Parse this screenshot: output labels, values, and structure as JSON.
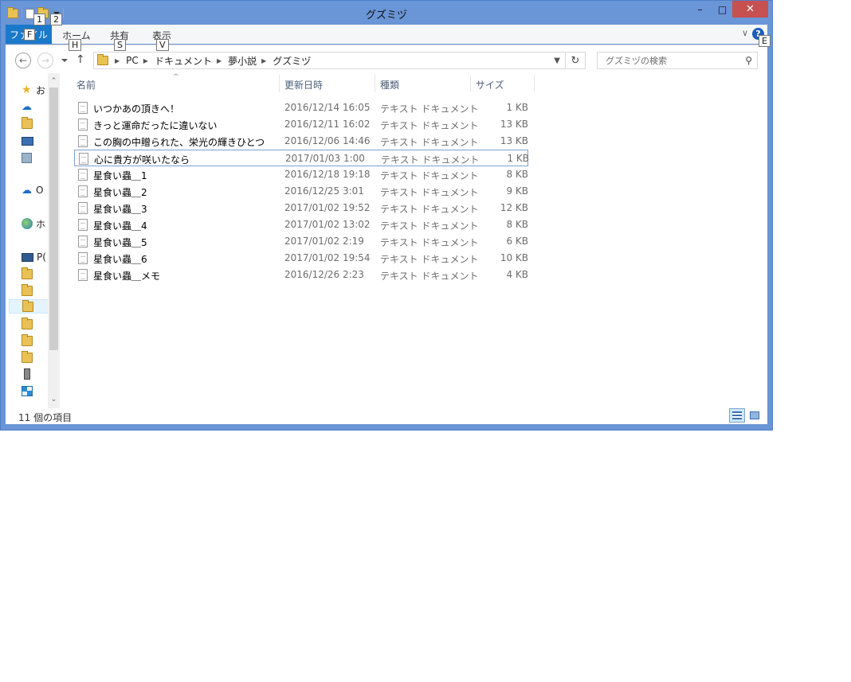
{
  "window": {
    "title": "グズミヅ",
    "minimize_glyph": "–",
    "maximize_glyph": "□",
    "close_glyph": "✕"
  },
  "keytips": {
    "qat_1": "1",
    "qat_2": "2",
    "file": "F",
    "home": "H",
    "share": "S",
    "view": "V",
    "help": "E"
  },
  "ribbon": {
    "file_tab": "ファイル",
    "tabs": [
      "ホーム",
      "共有",
      "表示"
    ],
    "collapse_glyph": "∨",
    "help_glyph": "?"
  },
  "navigation": {
    "back_glyph": "←",
    "forward_glyph": "→",
    "up_glyph": "↑",
    "refresh_glyph": "↻",
    "breadcrumb": [
      "PC",
      "ドキュメント",
      "夢小説",
      "グズミヅ"
    ],
    "search_placeholder": "グズミヅの検索",
    "search_glyph": "⚲"
  },
  "navpane": {
    "items": [
      {
        "label": "お",
        "icon": "star-icon"
      },
      {
        "label": "",
        "icon": "cloud-icon"
      },
      {
        "label": "",
        "icon": "downloads-folder-icon"
      },
      {
        "label": "",
        "icon": "desktop-icon"
      },
      {
        "label": "",
        "icon": "recent-places-icon"
      },
      {
        "label": "O",
        "icon": "onedrive-icon"
      },
      {
        "label": "ホ",
        "icon": "homegroup-icon"
      },
      {
        "label": "P(",
        "icon": "pc-icon"
      },
      {
        "label": "",
        "icon": "downloads-folder-icon"
      },
      {
        "label": "",
        "icon": "desktop-folder-icon"
      },
      {
        "label": "",
        "icon": "documents-folder-icon"
      },
      {
        "label": "",
        "icon": "pictures-folder-icon"
      },
      {
        "label": "",
        "icon": "music-folder-icon"
      },
      {
        "label": "",
        "icon": "videos-folder-icon"
      },
      {
        "label": "",
        "icon": "usb-drive-icon"
      },
      {
        "label": "",
        "icon": "network-icon"
      }
    ],
    "scroll_up": "⌃",
    "scroll_down": "⌄"
  },
  "columns": {
    "name": "名前",
    "date": "更新日時",
    "type": "種類",
    "size": "サイズ",
    "sort_glyph": "^"
  },
  "files": [
    {
      "name": "いつかあの頂きへ！",
      "date": "2016/12/14 16:05",
      "type": "テキスト ドキュメント",
      "size": "1 KB"
    },
    {
      "name": "きっと運命だったに違いない",
      "date": "2016/12/11 16:02",
      "type": "テキスト ドキュメント",
      "size": "13 KB"
    },
    {
      "name": "この胸の中贈られた、栄光の輝きひとつ",
      "date": "2016/12/06 14:46",
      "type": "テキスト ドキュメント",
      "size": "13 KB"
    },
    {
      "name": "心に貴方が咲いたなら",
      "date": "2017/01/03 1:00",
      "type": "テキスト ドキュメント",
      "size": "1 KB"
    },
    {
      "name": "星食い蟲＿1",
      "date": "2016/12/18 19:18",
      "type": "テキスト ドキュメント",
      "size": "8 KB"
    },
    {
      "name": "星食い蟲＿2",
      "date": "2016/12/25 3:01",
      "type": "テキスト ドキュメント",
      "size": "9 KB"
    },
    {
      "name": "星食い蟲＿3",
      "date": "2017/01/02 19:52",
      "type": "テキスト ドキュメント",
      "size": "12 KB"
    },
    {
      "name": "星食い蟲＿4",
      "date": "2017/01/02 13:02",
      "type": "テキスト ドキュメント",
      "size": "8 KB"
    },
    {
      "name": "星食い蟲＿5",
      "date": "2017/01/02 2:19",
      "type": "テキスト ドキュメント",
      "size": "6 KB"
    },
    {
      "name": "星食い蟲＿6",
      "date": "2017/01/02 19:54",
      "type": "テキスト ドキュメント",
      "size": "10 KB"
    },
    {
      "name": "星食い蟲＿メモ",
      "date": "2016/12/26 2:23",
      "type": "テキスト ドキュメント",
      "size": "4 KB"
    }
  ],
  "status": {
    "item_count": "11 個の項目"
  },
  "colors": {
    "window_frame": "#6a95d6",
    "file_tab": "#1979ca",
    "close_button": "#c75050",
    "focus_border": "#7da2ce"
  }
}
